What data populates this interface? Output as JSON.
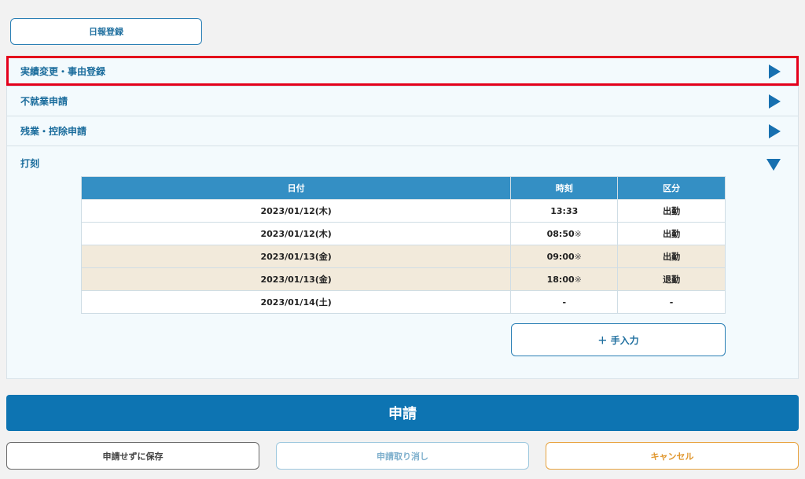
{
  "buttons": {
    "daily_report": "日報登録",
    "manual_input": "＋ 手入力",
    "submit": "申請",
    "save_without_submit": "申請せずに保存",
    "withdraw": "申請取り消し",
    "cancel": "キャンセル"
  },
  "accordion": {
    "items": [
      {
        "label": "実績変更・事由登録",
        "icon": "triangle-right-icon"
      },
      {
        "label": "不就業申請",
        "icon": "triangle-right-icon"
      },
      {
        "label": "残業・控除申請",
        "icon": "triangle-right-icon"
      }
    ],
    "stamp": {
      "label": "打刻",
      "icon": "triangle-down-icon"
    }
  },
  "table": {
    "headers": [
      "日付",
      "時刻",
      "区分"
    ],
    "rows": [
      {
        "date": "2023/01/12(木)",
        "time": "13:33",
        "note": "",
        "type": "出勤"
      },
      {
        "date": "2023/01/12(木)",
        "time": "08:50",
        "note": "※",
        "type": "出勤"
      },
      {
        "date": "2023/01/13(金)",
        "time": "09:00",
        "note": "※",
        "type": "出勤"
      },
      {
        "date": "2023/01/13(金)",
        "time": "18:00",
        "note": "※",
        "type": "退勤"
      },
      {
        "date": "2023/01/14(土)",
        "time": "-",
        "note": "",
        "type": "-"
      }
    ]
  },
  "colors": {
    "accent": "#0d74b2",
    "header_bg": "#348fc4",
    "row_highlight": "#f2eadb",
    "highlight_border": "#e4001b",
    "cancel": "#e0962c"
  }
}
